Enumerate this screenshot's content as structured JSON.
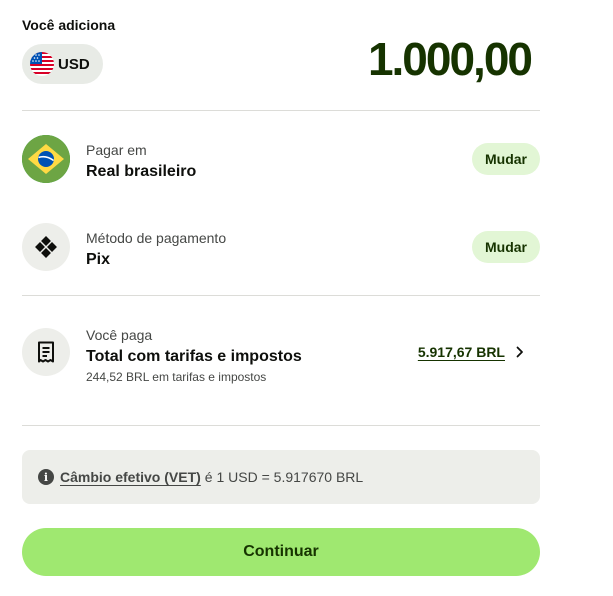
{
  "header": {
    "you_add_label": "Você adiciona",
    "currency_code": "USD",
    "amount": "1.000,00",
    "currency_flag_icon": "us-flag-icon"
  },
  "pay_in": {
    "sub_label": "Pagar em",
    "value": "Real brasileiro",
    "change_label": "Mudar",
    "icon": "brazil-flag-icon"
  },
  "payment_method": {
    "sub_label": "Método de pagamento",
    "value": "Pix",
    "change_label": "Mudar",
    "icon": "pix-icon"
  },
  "you_pay": {
    "sub_label": "Você paga",
    "value": "Total com tarifas e impostos",
    "fees_note": "244,52 BRL em tarifas e impostos",
    "total": "5.917,67 BRL",
    "icon": "receipt-icon"
  },
  "exchange_info": {
    "link_label": "Câmbio efetivo (VET)",
    "rate_text": "é 1 USD = 5.917670 BRL"
  },
  "actions": {
    "continue_label": "Continuar"
  },
  "colors": {
    "accent_green": "#9fe870",
    "dark_green": "#163300",
    "pill_green": "#e2f6d5",
    "neutral_bg": "#edeeea"
  }
}
